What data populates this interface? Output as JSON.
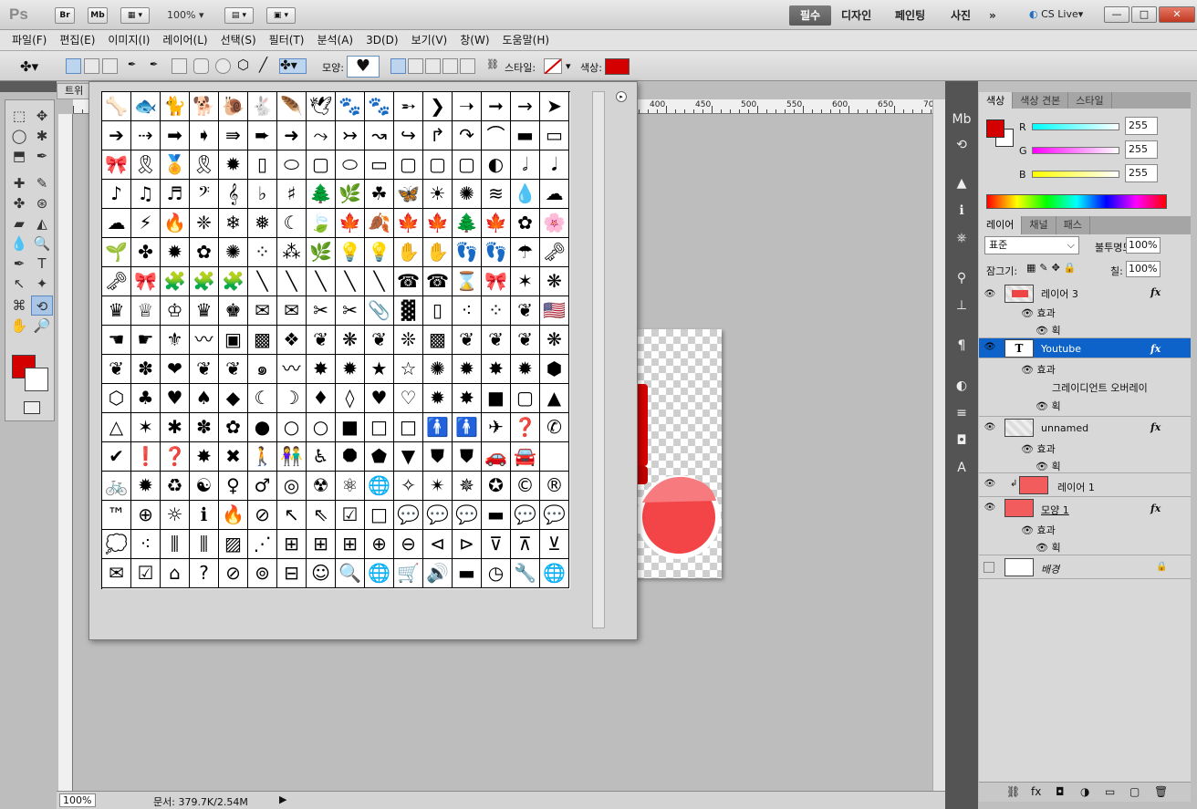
{
  "app": {
    "logo": "Ps",
    "bridge": "Br",
    "minibridge": "Mb",
    "zoom": "100%",
    "workspaces": [
      "필수",
      "디자인",
      "페인팅",
      "사진"
    ],
    "workspace_active": "필수",
    "more": "»",
    "cs_live": "CS Live▾",
    "win": {
      "min": "—",
      "max": "□",
      "close": "✕"
    }
  },
  "menu": [
    "파일(F)",
    "편집(E)",
    "이미지(I)",
    "레이어(L)",
    "선택(S)",
    "필터(T)",
    "분석(A)",
    "3D(D)",
    "보기(V)",
    "창(W)",
    "도움말(H)"
  ],
  "options": {
    "shape_label": "모양:",
    "style_label": "스타일:",
    "color_label": "색상:",
    "color": "#d40000",
    "shape_glyph": "♥"
  },
  "document": {
    "tab": "트위",
    "ruler_labels": [
      "400",
      "450",
      "500",
      "550",
      "600",
      "650",
      "70"
    ],
    "zoom": "100%",
    "info": "문서: 379.7K/2.54M"
  },
  "shape_picker": {
    "menu_icon": "▸",
    "shapes": [
      "🦴",
      "🐟",
      "🐈",
      "🐕",
      "🐌",
      "🐇",
      "🪶",
      "🕊",
      "🐾",
      "🐾",
      "➵",
      "❯",
      "➝",
      "➞",
      "→",
      "➤",
      "➔",
      "⇢",
      "➡",
      "➧",
      "⇛",
      "➨",
      "➜",
      "⤳",
      "↣",
      "↝",
      "↪",
      "↱",
      "↷",
      "⌒",
      "▬",
      "▭",
      "🎀",
      "🎗",
      "🏅",
      "🎗",
      "✹",
      "▯",
      "⬭",
      "▢",
      "⬭",
      "▭",
      "▢",
      "▢",
      "▢",
      "◐",
      "𝅗𝅥",
      "𝅘𝅥",
      "♪",
      "♫",
      "♬",
      "𝄢",
      "𝄞",
      "♭",
      "♯",
      "🌲",
      "🌿",
      "☘",
      "🦋",
      "☀",
      "✺",
      "≋",
      "💧",
      "☁",
      "☁",
      "⚡",
      "🔥",
      "❈",
      "❄",
      "❅",
      "☾",
      "🍃",
      "🍁",
      "🍂",
      "🍁",
      "🍁",
      "🌲",
      "🍁",
      "✿",
      "🌸",
      "🌱",
      "✤",
      "✹",
      "✿",
      "✺",
      "⁘",
      "⁂",
      "🌿",
      "💡",
      "💡",
      "✋",
      "✋",
      "👣",
      "👣",
      "☂",
      "🗝",
      "🗝",
      "🎀",
      "🧩",
      "🧩",
      "🧩",
      "╲",
      "╲",
      "╲",
      "╲",
      "╲",
      "☎",
      "☎",
      "⌛",
      "🎀",
      "✶",
      "❋",
      "♛",
      "♕",
      "♔",
      "♛",
      "♚",
      "✉",
      "✉",
      "✂",
      "✂",
      "📎",
      "▓",
      "▯",
      "⁖",
      "⁘",
      "❦",
      "🇺🇸",
      "☚",
      "☛",
      "⚜",
      "〰",
      "▣",
      "▩",
      "❖",
      "❦",
      "❋",
      "❦",
      "❊",
      "▩",
      "❦",
      "❦",
      "❦",
      "❋",
      "❦",
      "✽",
      "❤",
      "❦",
      "❦",
      "๑",
      "〰",
      "✸",
      "✹",
      "★",
      "☆",
      "✺",
      "✹",
      "✸",
      "✹",
      "⬢",
      "⬡",
      "♣",
      "♥",
      "♠",
      "◆",
      "☾",
      "☽",
      "♦",
      "◊",
      "♥",
      "♡",
      "✹",
      "✸",
      "■",
      "▢",
      "▲",
      "△",
      "✶",
      "✱",
      "✽",
      "✿",
      "●",
      "○",
      "○",
      "■",
      "□",
      "□",
      "🚹",
      "🚹",
      "✈",
      "❓",
      "✆",
      "✔",
      "❗",
      "❓",
      "✸",
      "✖",
      "🚶",
      "👫",
      "♿",
      "⯃",
      "⬟",
      "▼",
      "⛊",
      "⛊",
      "🚗",
      "🚘",
      "",
      "🚲",
      "✹",
      "♻",
      "☯",
      "♀",
      "♂",
      "◎",
      "☢",
      "⚛",
      "🌐",
      "✧",
      "✴",
      "✵",
      "✪",
      "©",
      "®",
      "™",
      "⊕",
      "☼",
      "ℹ",
      "🔥",
      "⊘",
      "↖",
      "⇖",
      "☑",
      "□",
      "💬",
      "💬",
      "💬",
      "▬",
      "💬",
      "💬",
      "💭",
      "⁖",
      "⫼",
      "⫼",
      "▨",
      "⋰",
      "⊞",
      "⊞",
      "⊞",
      "⊕",
      "⊖",
      "⊲",
      "⊳",
      "⊽",
      "⊼",
      "⊻",
      "✉",
      "☑",
      "⌂",
      "?",
      "⊘",
      "⊚",
      "⊟",
      "☺",
      "🔍",
      "🌐",
      "🛒",
      "🔊",
      "▬",
      "◷",
      "🔧",
      "🌐"
    ]
  },
  "tools": [
    "⬚",
    "✥",
    "◯",
    "✱",
    "⬒",
    "✒",
    "✚",
    "✎",
    "✤",
    "⊛",
    "▰",
    "◭",
    "💧",
    "🔍",
    "✒",
    "T",
    "↖",
    "✦",
    "⌘",
    "⟲",
    "✋",
    "🔎"
  ],
  "color_panel": {
    "tabs": [
      "색상",
      "색상 견본",
      "스타일"
    ],
    "r_label": "R",
    "g_label": "G",
    "b_label": "B",
    "r": "255",
    "g": "255",
    "b": "255"
  },
  "layers_panel": {
    "tabs": [
      "레이어",
      "채널",
      "패스"
    ],
    "blend": "표준",
    "opacity_label": "불투명도:",
    "opacity": "100%",
    "lock_label": "잠그기:",
    "fill_label": "칠:",
    "fill": "100%",
    "layers": [
      {
        "name": "레이어 3",
        "fx": "fx",
        "effect": "효과",
        "sub": [
          "획"
        ]
      },
      {
        "name": "Youtube",
        "fx": "fx",
        "effect": "효과",
        "sub": [
          "그레이디언트 오버레이",
          "획"
        ]
      },
      {
        "name": "unnamed",
        "fx": "fx",
        "effect": "효과",
        "sub": [
          "획"
        ]
      },
      {
        "name": "레이어 1"
      },
      {
        "name": "모양 1",
        "fx": "fx",
        "effect": "효과",
        "sub": [
          "획"
        ]
      },
      {
        "name": "배경"
      }
    ],
    "footer_icons": [
      "⛓",
      "fx",
      "◘",
      "◑",
      "▭",
      "▢",
      "🗑"
    ]
  }
}
